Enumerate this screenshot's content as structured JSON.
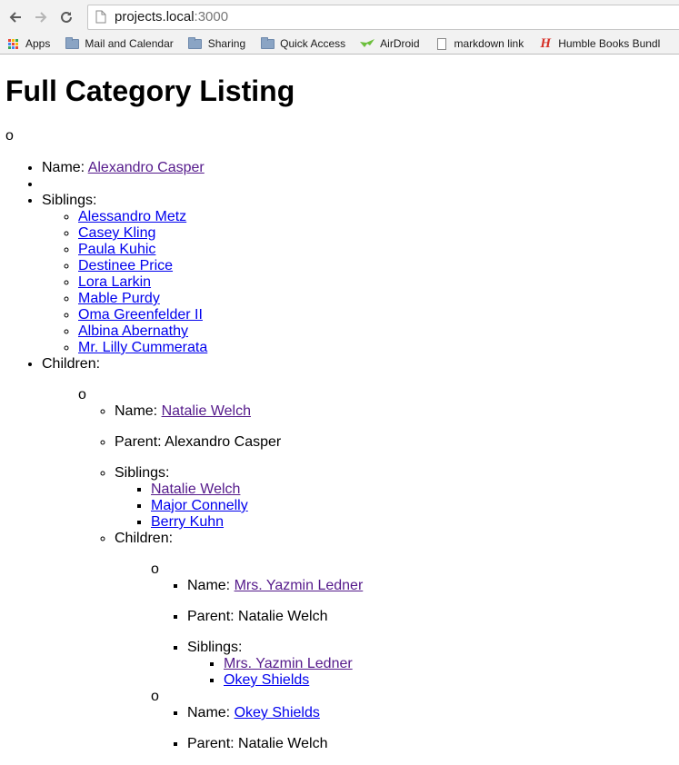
{
  "browser": {
    "url_host": "projects.local",
    "url_port": ":3000",
    "bookmarks": [
      {
        "label": "Apps",
        "icon": "apps-grid-icon"
      },
      {
        "label": "Mail and Calendar",
        "icon": "folder-icon"
      },
      {
        "label": "Sharing",
        "icon": "folder-icon"
      },
      {
        "label": "Quick Access",
        "icon": "folder-icon"
      },
      {
        "label": "AirDroid",
        "icon": "airdroid-icon"
      },
      {
        "label": "markdown link",
        "icon": "page-icon"
      },
      {
        "label": "Humble Books Bundl",
        "icon": "humble-icon"
      }
    ]
  },
  "page": {
    "title": "Full Category Listing",
    "marker": "o",
    "name_label": "Name:",
    "parent_label": "Parent:",
    "siblings_label": "Siblings:",
    "children_label": "Children:",
    "root": {
      "name": "Alexandro Casper",
      "siblings": [
        "Alessandro Metz",
        "Casey Kling",
        "Paula Kuhic",
        "Destinee Price",
        "Lora Larkin",
        "Mable Purdy",
        "Oma Greenfelder II",
        "Albina Abernathy",
        "Mr. Lilly Cummerata"
      ],
      "child": {
        "name": "Natalie Welch",
        "parent": "Alexandro Casper",
        "siblings": [
          "Natalie Welch",
          "Major Connelly",
          "Berry Kuhn"
        ],
        "children": [
          {
            "name": "Mrs. Yazmin Ledner",
            "parent": "Natalie Welch",
            "siblings": [
              "Mrs. Yazmin Ledner",
              "Okey Shields"
            ]
          },
          {
            "name": "Okey Shields",
            "parent": "Natalie Welch"
          }
        ]
      }
    }
  }
}
